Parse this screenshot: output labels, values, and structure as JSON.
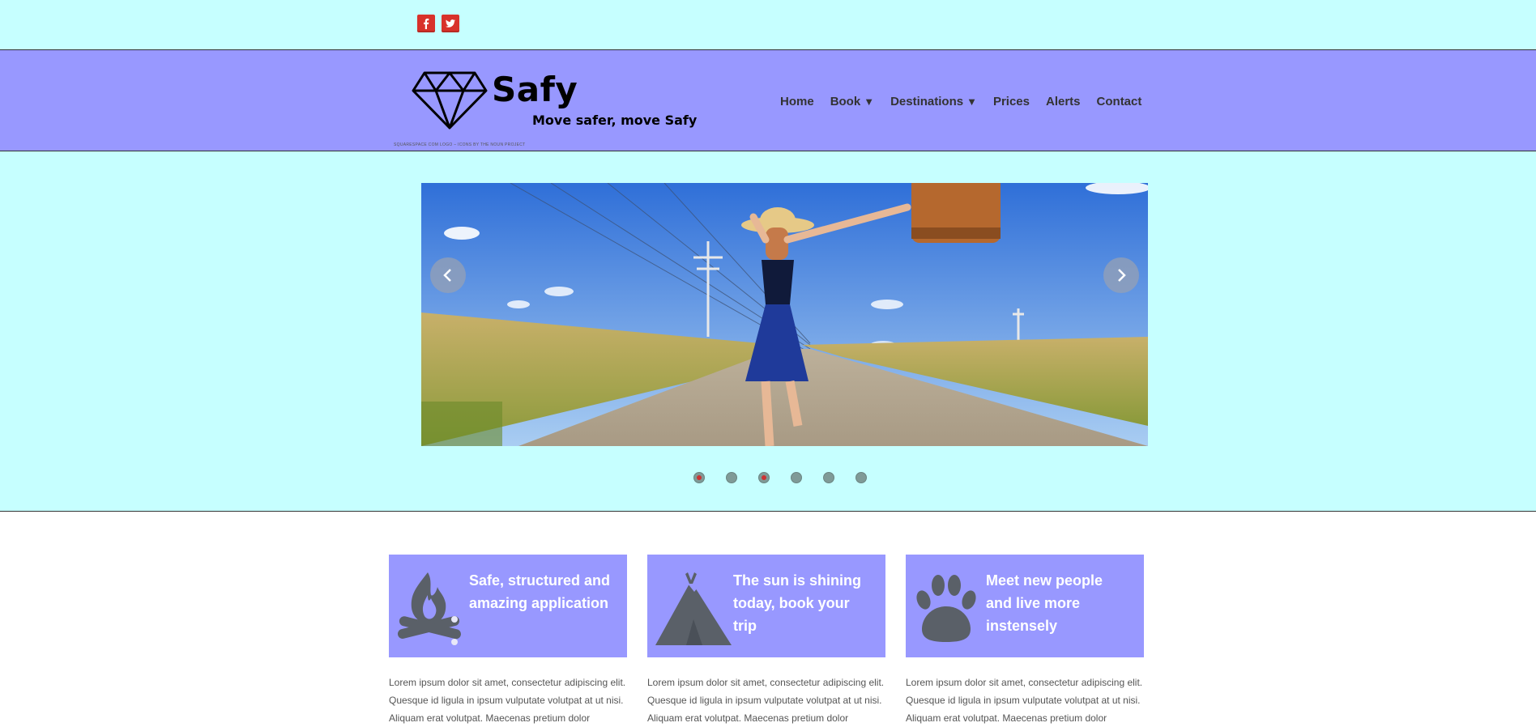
{
  "colors": {
    "top_strip": "#c6ffff",
    "header": "#9898ff",
    "hero": "#c6ffff",
    "feature_box": "#9898ff",
    "social_icon": "#d8322b",
    "dot_active": "#cc3333"
  },
  "social": [
    {
      "name": "facebook",
      "icon": "facebook-icon",
      "glyph": "f"
    },
    {
      "name": "twitter",
      "icon": "twitter-icon",
      "glyph": "bird"
    }
  ],
  "brand": {
    "name": "Safy",
    "tagline": "Move safer, move Safy",
    "credit": "SQUARESPACE COM LOGO – ICONS BY THE NOUN PROJECT",
    "logo_icon": "diamond-icon"
  },
  "nav": [
    {
      "label": "Home",
      "has_dropdown": false
    },
    {
      "label": "Book",
      "has_dropdown": true
    },
    {
      "label": "Destinations",
      "has_dropdown": true
    },
    {
      "label": "Prices",
      "has_dropdown": false
    },
    {
      "label": "Alerts",
      "has_dropdown": false
    },
    {
      "label": "Contact",
      "has_dropdown": false
    }
  ],
  "caret": "▼",
  "slider": {
    "image": "woman-with-suitcase-on-country-road",
    "prev_icon": "chevron-left-icon",
    "next_icon": "chevron-right-icon",
    "dot_count": 6,
    "active_dots": [
      1,
      3
    ]
  },
  "features": [
    {
      "icon": "campfire-icon",
      "title": "Safe, structured and amazing application",
      "text": "Lorem ipsum dolor sit amet, consectetur adipiscing elit. Quesque id ligula in ipsum vulputate volutpat at ut nisi. Aliquam erat volutpat. Maecenas pretium dolor"
    },
    {
      "icon": "tent-icon",
      "title": "The sun is shining today, book your trip",
      "text": "Lorem ipsum dolor sit amet, consectetur adipiscing elit. Quesque id ligula in ipsum vulputate volutpat at ut nisi. Aliquam erat volutpat. Maecenas pretium dolor"
    },
    {
      "icon": "paw-icon",
      "title": "Meet new people and live more instensely",
      "text": "Lorem ipsum dolor sit amet, consectetur adipiscing elit. Quesque id ligula in ipsum vulputate volutpat at ut nisi. Aliquam erat volutpat. Maecenas pretium dolor"
    }
  ]
}
